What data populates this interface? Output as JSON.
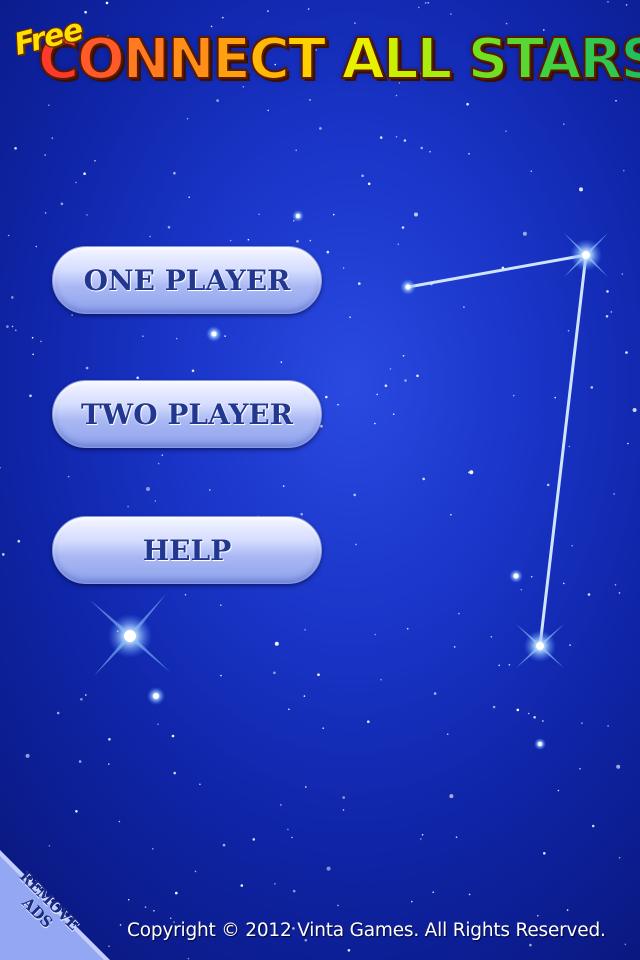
{
  "title": {
    "free_label": "Free",
    "letters": [
      {
        "text": "C",
        "color": "#ff3a2a"
      },
      {
        "text": "O",
        "color": "#ff5a28"
      },
      {
        "text": "N",
        "color": "#ff7a20"
      },
      {
        "text": "N",
        "color": "#ff8f18"
      },
      {
        "text": "E",
        "color": "#ffa010"
      },
      {
        "text": "C",
        "color": "#ffb808"
      },
      {
        "text": "T",
        "color": "#ffd000"
      },
      {
        "text": " ",
        "color": "#ffffff"
      },
      {
        "text": "A",
        "color": "#e8f000"
      },
      {
        "text": "L",
        "color": "#c8f000"
      },
      {
        "text": "L",
        "color": "#a8ec10"
      },
      {
        "text": " ",
        "color": "#ffffff"
      },
      {
        "text": "S",
        "color": "#70e020"
      },
      {
        "text": "T",
        "color": "#58d830"
      },
      {
        "text": "A",
        "color": "#40d040"
      },
      {
        "text": "R",
        "color": "#30c850"
      },
      {
        "text": "S",
        "color": "#20c060"
      }
    ]
  },
  "menu": {
    "one_player": "ONE PLAYER",
    "two_player": "TWO PLAYER",
    "help": "HELP"
  },
  "remove_ads": {
    "line1": "REMOVE",
    "line2": "ADS"
  },
  "footer": {
    "copyright": "Copyright © 2012  Vinta Games. All Rights Reserved."
  },
  "colors": {
    "background": "#1a35c8",
    "button_text": "#22378f",
    "constellation_line": "#cfe4ff"
  }
}
